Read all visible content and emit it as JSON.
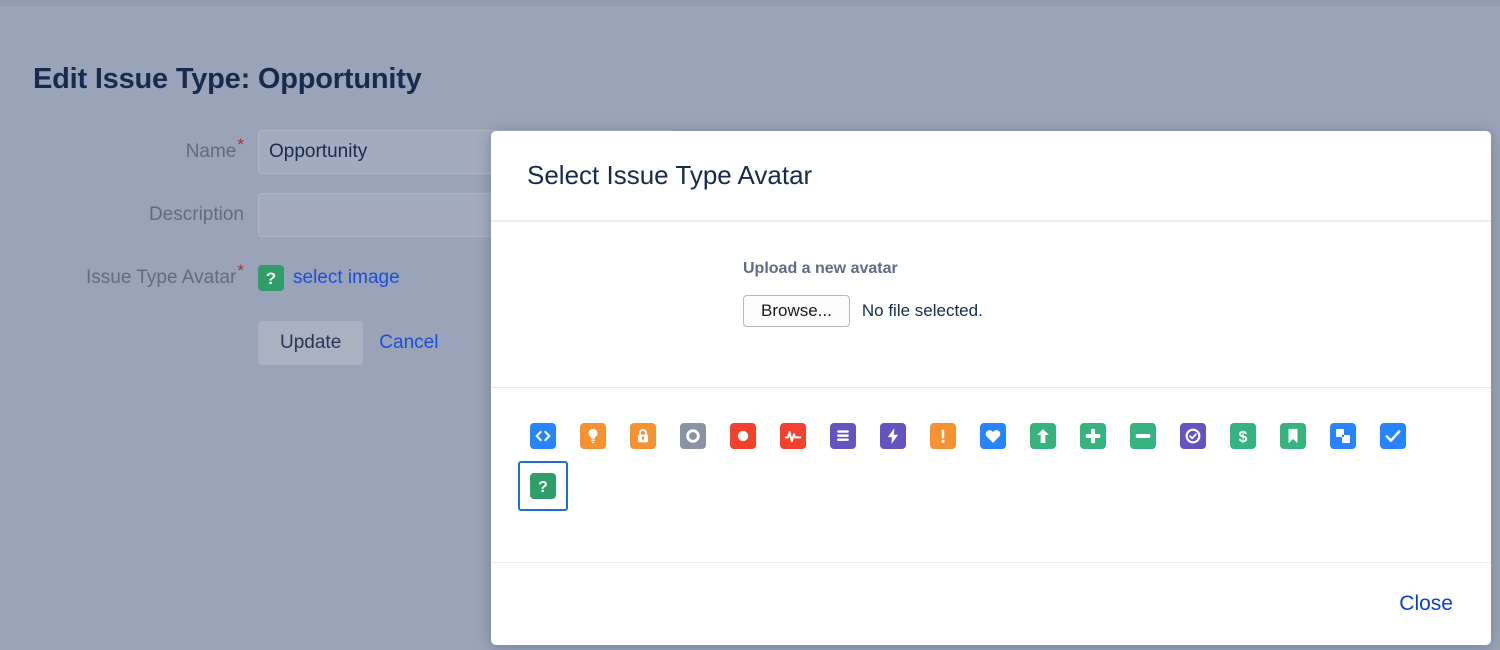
{
  "page": {
    "title": "Edit Issue Type: Opportunity",
    "form": {
      "name_label": "Name",
      "name_value": "Opportunity",
      "name_placeholder": "",
      "description_label": "Description",
      "description_value": "",
      "description_placeholder": "",
      "avatar_label": "Issue Type Avatar",
      "avatar_link_text": "select image",
      "avatar_glyph": "?",
      "required_marker": "*",
      "update_label": "Update",
      "cancel_label": "Cancel"
    }
  },
  "modal": {
    "title": "Select Issue Type Avatar",
    "upload_heading": "Upload a new avatar",
    "browse_label": "Browse...",
    "file_status": "No file selected.",
    "close_label": "Close",
    "selection_border_color": "#1f6fd0",
    "avatars": [
      {
        "name": "code-icon",
        "icon": "code",
        "bg": "#2684ff"
      },
      {
        "name": "lightbulb-icon",
        "icon": "bulb",
        "bg": "#f79232"
      },
      {
        "name": "lock-icon",
        "icon": "lock",
        "bg": "#f79232"
      },
      {
        "name": "ring-icon",
        "icon": "ring",
        "bg": "#8993a4"
      },
      {
        "name": "circle-icon",
        "icon": "circle",
        "bg": "#f4412e"
      },
      {
        "name": "pulse-icon",
        "icon": "pulse",
        "bg": "#f4412e"
      },
      {
        "name": "document-icon",
        "icon": "document",
        "bg": "#6554c0"
      },
      {
        "name": "bolt-icon",
        "icon": "bolt",
        "bg": "#6554c0"
      },
      {
        "name": "exclamation-icon",
        "icon": "exclaim",
        "bg": "#f79232"
      },
      {
        "name": "heart-icon",
        "icon": "heart",
        "bg": "#2684ff"
      },
      {
        "name": "arrow-up-icon",
        "icon": "arrowup",
        "bg": "#36b37e"
      },
      {
        "name": "plus-icon",
        "icon": "plus",
        "bg": "#36b37e"
      },
      {
        "name": "minus-icon",
        "icon": "minus",
        "bg": "#36b37e"
      },
      {
        "name": "check-circle-icon",
        "icon": "checkcircle",
        "bg": "#6554c0"
      },
      {
        "name": "dollar-icon",
        "icon": "dollar",
        "bg": "#36b37e"
      },
      {
        "name": "bookmark-icon",
        "icon": "bookmark",
        "bg": "#36b37e"
      },
      {
        "name": "layers-icon",
        "icon": "layers",
        "bg": "#2684ff"
      },
      {
        "name": "checkmark-icon",
        "icon": "check",
        "bg": "#2684ff"
      },
      {
        "name": "question-mark-icon",
        "icon": "question",
        "bg": "#2f9e68",
        "selected": true
      }
    ]
  }
}
